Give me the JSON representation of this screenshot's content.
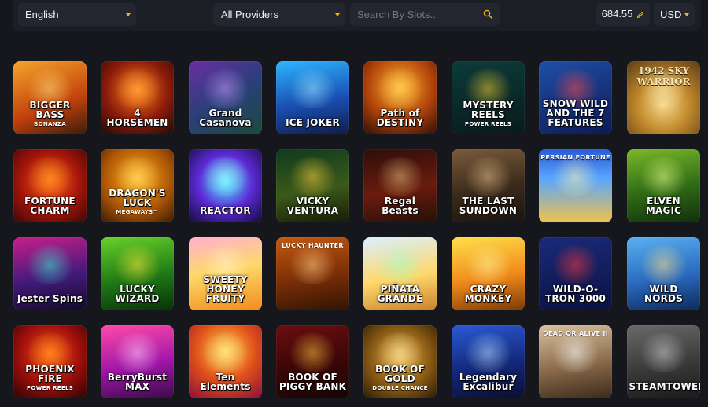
{
  "toolbar": {
    "language": "English",
    "providers": "All Providers",
    "search_placeholder": "Search By Slots...",
    "balance": "684.55",
    "currency": "USD",
    "accent": "#f0b90b"
  },
  "games": [
    {
      "top": "",
      "title": "BIGGER BASS",
      "sub": "BONANZA",
      "bg": "linear-gradient(160deg,#f4a52b,#c2410c 60%,#3a1d0a)",
      "glow": "#ffe07a"
    },
    {
      "top": "",
      "title": "4 HORSEMEN",
      "sub": "",
      "bg": "radial-gradient(circle at 50% 40%,#ff7a1a,#8a1b0a 55%,#1e0a08)",
      "glow": "#ffb347"
    },
    {
      "top": "",
      "title": "Grand Casanova",
      "sub": "",
      "bg": "linear-gradient(150deg,#6a2ea3,#2a3f7a 50%,#1b4b3a)",
      "glow": "#c79bff"
    },
    {
      "top": "",
      "title": "ICE JOKER",
      "sub": "",
      "bg": "linear-gradient(170deg,#2cb6ff,#1a4fb3 55%,#101c4a)",
      "glow": "#9fe6ff"
    },
    {
      "top": "",
      "title": "Path of DESTINY",
      "sub": "",
      "bg": "radial-gradient(circle at 50% 35%,#ffb12b,#b0420a 55%,#2b0f06)",
      "glow": "#ffd86b"
    },
    {
      "top": "",
      "title": "MYSTERY REELS",
      "sub": "POWER REELS",
      "bg": "linear-gradient(170deg,#0b3b3a,#0a1a1c)",
      "glow": "#f6d12d"
    },
    {
      "top": "",
      "title": "SNOW WILD AND THE 7 FEATURES",
      "sub": "",
      "bg": "linear-gradient(160deg,#1f4fa8,#0d1a55)",
      "glow": "#ff4a4a"
    },
    {
      "top": "1942 SKY WARRIOR",
      "title": "",
      "sub": "",
      "bg": "radial-gradient(circle at 50% 60%,#f7d78a,#c28a2c 45%,#5a3a14)",
      "glow": "#fff0b5"
    },
    {
      "top": "",
      "title": "FORTUNE CHARM",
      "sub": "",
      "bg": "radial-gradient(circle at 50% 45%,#ff5a1e,#a3150a 55%,#3c0606)",
      "glow": "#ffb21e"
    },
    {
      "top": "",
      "title": "DRAGON'S LUCK",
      "sub": "MEGAWAYS™",
      "bg": "radial-gradient(circle at 50% 40%,#ffb21e,#b35a06 55%,#3a1a04)",
      "glow": "#ffe07a"
    },
    {
      "top": "",
      "title": "REACTOR",
      "sub": "",
      "bg": "radial-gradient(circle at 50% 45%,#4af0ff,#5d2ad6 50%,#140a3a)",
      "glow": "#b9f5ff"
    },
    {
      "top": "",
      "title": "VICKY VENTURA",
      "sub": "",
      "bg": "linear-gradient(170deg,#0f3a1e,#3b5a1a 55%,#1a1a08)",
      "glow": "#ffd23d"
    },
    {
      "top": "",
      "title": "Regal Beasts",
      "sub": "",
      "bg": "linear-gradient(170deg,#2e0d0a,#6a1c0e 55%,#241008)",
      "glow": "#e3c27a"
    },
    {
      "top": "",
      "title": "THE LAST SUNDOWN",
      "sub": "",
      "bg": "linear-gradient(170deg,#7a5b3a,#3a2a1a 55%,#1a1410)",
      "glow": "#e5c08a"
    },
    {
      "top": "PERSIAN FORTUNE",
      "title": "",
      "sub": "",
      "bg": "linear-gradient(180deg,#2a5ad6,#5aa6ff 40%,#f0c14a)",
      "glow": "#fff3b0"
    },
    {
      "top": "",
      "title": "ELVEN MAGIC",
      "sub": "",
      "bg": "linear-gradient(170deg,#7ab82a,#2f6a16 55%,#12300a)",
      "glow": "#eaff8a"
    },
    {
      "top": "",
      "title": "Jester Spins",
      "sub": "",
      "bg": "linear-gradient(170deg,#c81e8a,#421a7a 55%,#140a2a)",
      "glow": "#36f0d0"
    },
    {
      "top": "",
      "title": "LUCKY WIZARD",
      "sub": "",
      "bg": "linear-gradient(170deg,#6ad02a,#1f7a16 55%,#0a300a)",
      "glow": "#ffe83d"
    },
    {
      "top": "",
      "title": "SWEETY HONEY FRUITY",
      "sub": "",
      "bg": "linear-gradient(170deg,#ffb0d0,#ffd86b 45%,#f28c1a)",
      "glow": "#fff6c8"
    },
    {
      "top": "LUCKY HAUNTER",
      "title": "",
      "sub": "",
      "bg": "linear-gradient(170deg,#c45a10,#7a2e06 55%,#2e1404)",
      "glow": "#ffd08a"
    },
    {
      "top": "",
      "title": "PIÑATA GRANDE",
      "sub": "",
      "bg": "linear-gradient(170deg,#d9f0ff,#ffd86b 55%,#c9822a)",
      "glow": "#9fffc6"
    },
    {
      "top": "",
      "title": "CRAZY MONKEY",
      "sub": "",
      "bg": "linear-gradient(170deg,#ffe04a,#f08a1a 55%,#7a3a06)",
      "glow": "#fff6a0"
    },
    {
      "top": "",
      "title": "WILD-O-TRON 3000",
      "sub": "",
      "bg": "linear-gradient(170deg,#1a2a7a,#0a1240)",
      "glow": "#ff3a3a"
    },
    {
      "top": "",
      "title": "WILD NORDS",
      "sub": "",
      "bg": "linear-gradient(170deg,#5ab0f0,#2a6ac0 55%,#0e2a5a)",
      "glow": "#ffe083"
    },
    {
      "top": "",
      "title": "PHOENIX FIRE",
      "sub": "POWER REELS",
      "bg": "radial-gradient(circle at 50% 40%,#ff4a1a,#9a0e0a 55%,#2a0404)",
      "glow": "#ffb21e"
    },
    {
      "top": "",
      "title": "BerryBurst MAX",
      "sub": "",
      "bg": "linear-gradient(170deg,#ff4aa8,#a016a8 55%,#3a0a4a)",
      "glow": "#ffd0ff"
    },
    {
      "top": "",
      "title": "Ten Elements",
      "sub": "",
      "bg": "radial-gradient(circle at 50% 35%,#ffd04a,#e0501a 50%,#8a0e3a)",
      "glow": "#fff0a0"
    },
    {
      "top": "",
      "title": "BOOK OF PIGGY BANK",
      "sub": "",
      "bg": "linear-gradient(170deg,#6a0e10,#3a0606 55%,#1a0404)",
      "glow": "#ffc43d"
    },
    {
      "top": "",
      "title": "BOOK OF GOLD",
      "sub": "DOUBLE CHANCE",
      "bg": "radial-gradient(circle at 50% 45%,#e8b04a,#8a5a14 55%,#2a1a06)",
      "glow": "#fff0b0"
    },
    {
      "top": "",
      "title": "Legendary Excalibur",
      "sub": "",
      "bg": "linear-gradient(170deg,#2a5ad6,#14287a 55%,#0a0e30)",
      "glow": "#bde0ff"
    },
    {
      "top": "DEAD OR ALIVE II",
      "title": "",
      "sub": "",
      "bg": "linear-gradient(170deg,#d8c2a0,#8a6a4a 55%,#3a2a1a)",
      "glow": "#fff"
    },
    {
      "top": "",
      "title": "STEAMTOWER",
      "sub": "",
      "bg": "linear-gradient(170deg,#6a6a6a,#3a3a3a 55%,#1a1a1a)",
      "glow": "#d0d0d0"
    }
  ]
}
